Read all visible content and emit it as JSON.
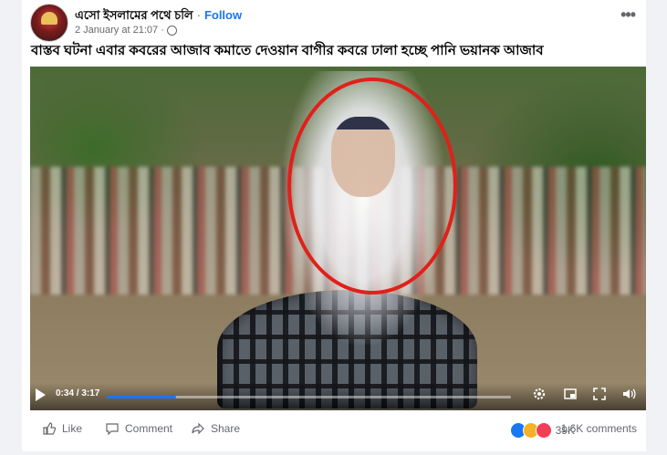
{
  "post": {
    "page_name": "এসো ইসলামের পথে চলি",
    "separator": "·",
    "follow_label": "Follow",
    "timestamp": "2 January at 21:07 ·",
    "more_label": "•••",
    "caption": "বাস্তব ঘটনা এবার কবরের আজাব কমাতে দেওয়ান বাগীর কবরে ঢালা হচ্ছে পানি ভয়ানক আজাব"
  },
  "video": {
    "current_time": "0:34",
    "total_time": "3:17",
    "time_text": "0:34 / 3:17",
    "progress_fraction": 0.172
  },
  "actions": {
    "like_label": "Like",
    "comment_label": "Comment",
    "share_label": "Share"
  },
  "stats": {
    "reactions_count": "39K",
    "comments_count": "1.6K comments"
  },
  "colors": {
    "accent": "#1877f2",
    "highlight_ring": "#e0201a"
  }
}
